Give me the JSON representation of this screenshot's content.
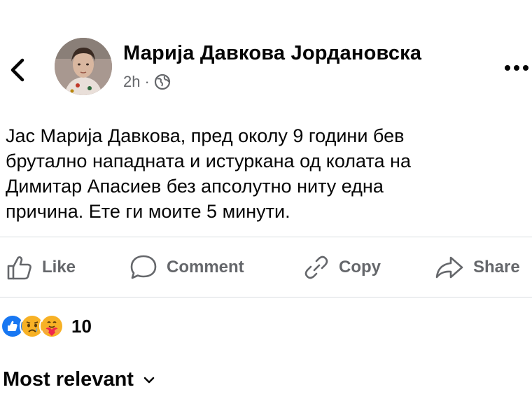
{
  "post": {
    "author": "Марија Давкова Јордановска",
    "time": "2h",
    "separator": "·",
    "text": "Јас Марија Давкова, пред околу 9 години бев\nбрутално нападната и истуркана од колата на\nДимитар Апасиев без апсолутно ниту една\nпричина. Ете ги моите 5 минути."
  },
  "actions": {
    "like_label": "Like",
    "comment_label": "Comment",
    "copy_label": "Copy",
    "share_label": "Share"
  },
  "reactions": {
    "icons": [
      "like-icon",
      "sad-icon",
      "care-icon"
    ],
    "count": "10"
  },
  "comments": {
    "sort_label": "Most relevant"
  },
  "colors": {
    "text": "#050505",
    "secondary": "#65676b",
    "like_blue": "#1877f2",
    "divider": "#dadde1"
  }
}
